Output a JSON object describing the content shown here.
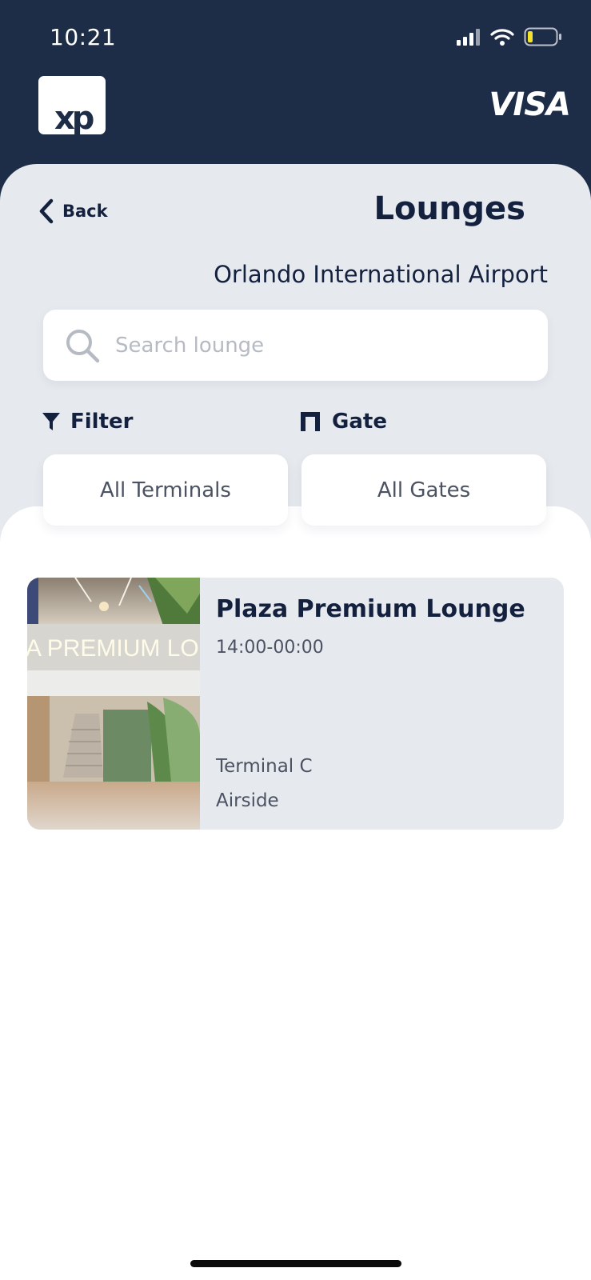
{
  "status_bar": {
    "time": "10:21",
    "icons": [
      "signal-icon",
      "wifi-icon",
      "battery-icon"
    ]
  },
  "header": {
    "logo_text": "xp",
    "card_brand": "VISA"
  },
  "nav": {
    "back_label": "Back",
    "title": "Lounges"
  },
  "airport": {
    "name": "Orlando International Airport"
  },
  "search": {
    "placeholder": "Search lounge",
    "value": ""
  },
  "filters": {
    "filter_label": "Filter",
    "gate_label": "Gate",
    "terminal_value": "All Terminals",
    "gate_value": "All Gates"
  },
  "lounges": [
    {
      "name": "Plaza Premium Lounge",
      "hours": "14:00-00:00",
      "terminal": "Terminal C",
      "side": "Airside",
      "photo_sign_text": "A PREMIUM LO"
    }
  ],
  "colors": {
    "navy": "#1e2d47",
    "text": "#13213f",
    "panel": "#e6e9ee",
    "muted": "#4b5262"
  }
}
